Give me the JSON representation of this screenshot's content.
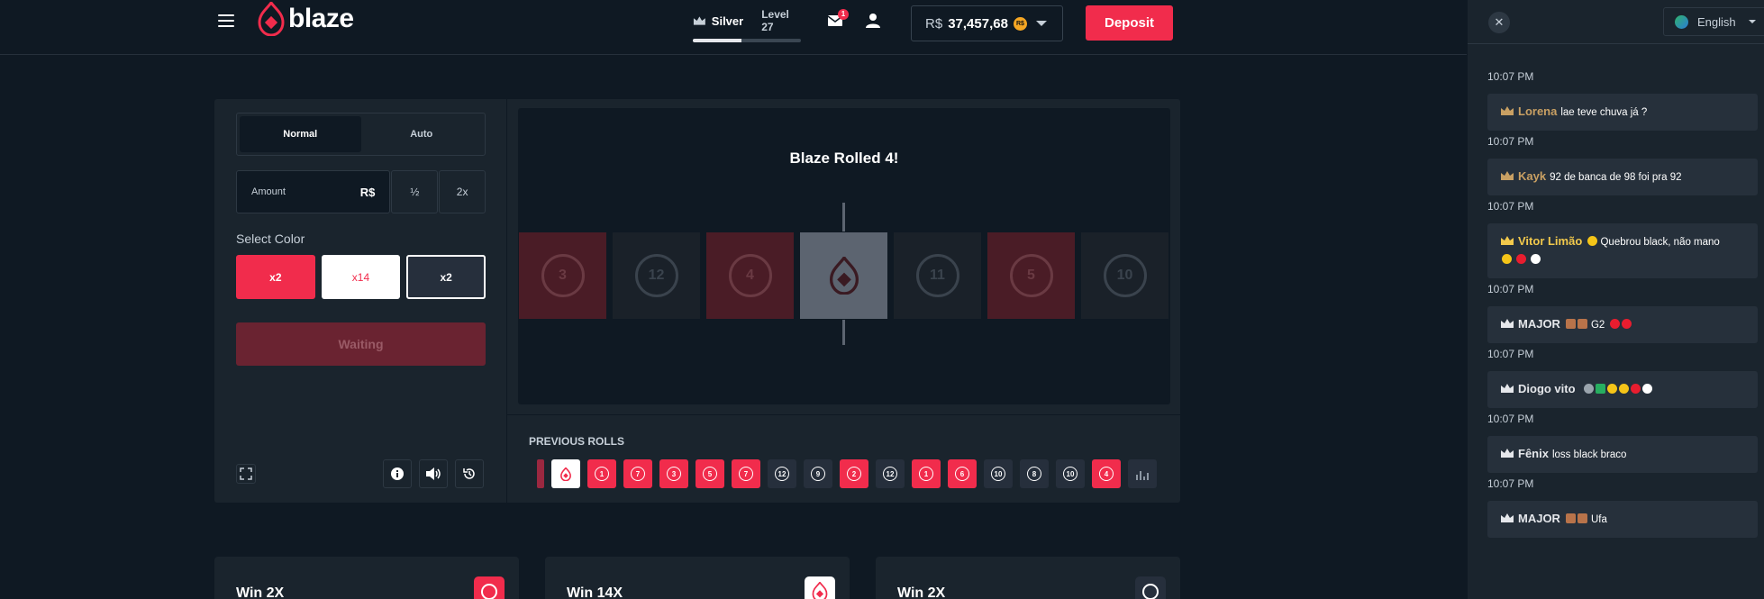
{
  "header": {
    "brand": "blaze",
    "rank_name": "Silver",
    "rank_level": "Level 27",
    "rank_progress": 0.45,
    "mail_count": "1",
    "balance_currency": "R$",
    "balance_amount": "37,457,68",
    "coin_label": "R$",
    "deposit_label": "Deposit"
  },
  "controls": {
    "tab_normal": "Normal",
    "tab_auto": "Auto",
    "amount_label": "Amount",
    "amount_currency": "R$",
    "half_label": "½",
    "double_label": "2x",
    "select_color_label": "Select Color",
    "color_red": "x2",
    "color_white": "x14",
    "color_black": "x2",
    "waiting_label": "Waiting"
  },
  "stage": {
    "rolled_text": "Blaze Rolled 4!",
    "tiles": [
      {
        "num": "3",
        "color": "red"
      },
      {
        "num": "12",
        "color": "black"
      },
      {
        "num": "4",
        "color": "red"
      },
      {
        "num": "",
        "color": "center"
      },
      {
        "num": "11",
        "color": "black"
      },
      {
        "num": "5",
        "color": "red"
      },
      {
        "num": "10",
        "color": "black"
      }
    ]
  },
  "previous": {
    "label": "PREVIOUS ROLLS",
    "rolls": [
      {
        "num": "",
        "color": "white"
      },
      {
        "num": "1",
        "color": "red"
      },
      {
        "num": "7",
        "color": "red"
      },
      {
        "num": "3",
        "color": "red"
      },
      {
        "num": "5",
        "color": "red"
      },
      {
        "num": "7",
        "color": "red"
      },
      {
        "num": "12",
        "color": "black"
      },
      {
        "num": "9",
        "color": "black"
      },
      {
        "num": "2",
        "color": "red"
      },
      {
        "num": "12",
        "color": "black"
      },
      {
        "num": "1",
        "color": "red"
      },
      {
        "num": "6",
        "color": "red"
      },
      {
        "num": "10",
        "color": "black"
      },
      {
        "num": "8",
        "color": "black"
      },
      {
        "num": "10",
        "color": "black"
      },
      {
        "num": "4",
        "color": "red"
      }
    ]
  },
  "cards": [
    {
      "title": "Win 2X"
    },
    {
      "title": "Win 14X"
    },
    {
      "title": "Win 2X"
    }
  ],
  "chat": {
    "language": "English",
    "messages": [
      {
        "time": "10:07 PM"
      },
      {
        "name": "Lorena",
        "name_color": "gold",
        "text": "lae teve chuva já ?",
        "time": "10:07 PM"
      },
      {
        "name": "Kayk",
        "name_color": "gold",
        "text": "92 de banca de 98 foi pra 92",
        "time": "10:07 PM"
      },
      {
        "name": "Vitor Limão",
        "name_color": "yellow",
        "text": "Quebrou black, não mano",
        "time": "10:07 PM"
      },
      {
        "name": "MAJOR",
        "name_color": "white",
        "text": "G2",
        "time": "10:07 PM"
      },
      {
        "name": "Diogo vito",
        "name_color": "white",
        "text": "",
        "time": "10:07 PM"
      },
      {
        "name": "Fênix",
        "name_color": "white",
        "text": "loss black braco",
        "time": "10:07 PM"
      },
      {
        "name": "MAJOR",
        "name_color": "white",
        "text": "Ufa"
      }
    ]
  }
}
